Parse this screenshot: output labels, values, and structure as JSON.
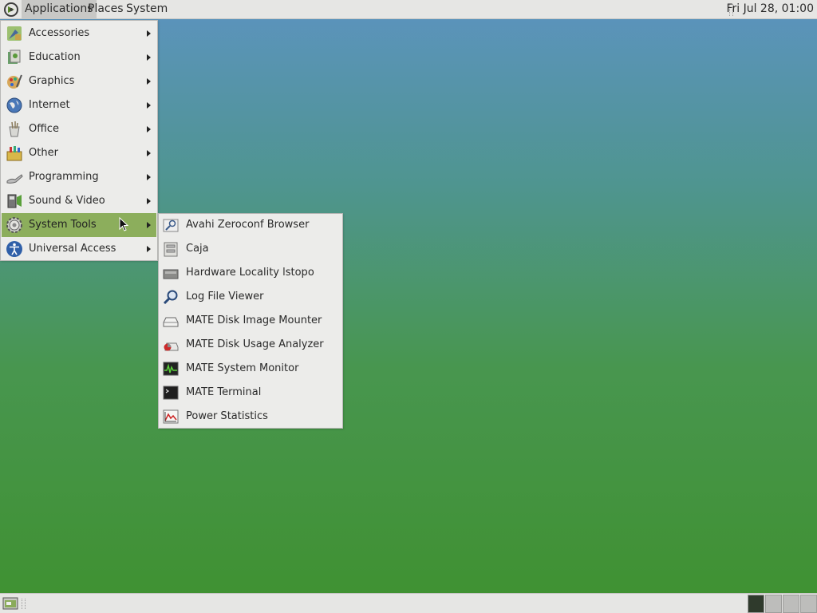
{
  "top_panel": {
    "menus": [
      "Applications",
      "Places",
      "System"
    ],
    "clock": "Fri Jul 28, 01:00"
  },
  "main_menu": {
    "items": [
      {
        "label": "Accessories",
        "icon": "accessories-icon"
      },
      {
        "label": "Education",
        "icon": "education-icon"
      },
      {
        "label": "Graphics",
        "icon": "graphics-icon"
      },
      {
        "label": "Internet",
        "icon": "internet-globe-icon"
      },
      {
        "label": "Office",
        "icon": "office-icon"
      },
      {
        "label": "Other",
        "icon": "other-toolbox-icon"
      },
      {
        "label": "Programming",
        "icon": "programming-icon"
      },
      {
        "label": "Sound & Video",
        "icon": "sound-video-icon"
      },
      {
        "label": "System Tools",
        "icon": "system-tools-gear-icon",
        "highlighted": true
      },
      {
        "label": "Universal Access",
        "icon": "universal-access-icon"
      }
    ]
  },
  "system_tools_submenu": {
    "items": [
      {
        "label": "Avahi Zeroconf Browser",
        "icon": "avahi-browser-icon"
      },
      {
        "label": "Caja",
        "icon": "caja-file-manager-icon"
      },
      {
        "label": "Hardware Locality lstopo",
        "icon": "hardware-locality-icon"
      },
      {
        "label": "Log File Viewer",
        "icon": "log-viewer-magnifier-icon"
      },
      {
        "label": "MATE Disk Image Mounter",
        "icon": "disk-image-mounter-icon"
      },
      {
        "label": "MATE Disk Usage Analyzer",
        "icon": "disk-usage-analyzer-icon"
      },
      {
        "label": "MATE System Monitor",
        "icon": "system-monitor-icon"
      },
      {
        "label": "MATE Terminal",
        "icon": "terminal-icon"
      },
      {
        "label": "Power Statistics",
        "icon": "power-statistics-icon"
      }
    ]
  },
  "colors": {
    "panel_bg": "#e6e6e4",
    "menu_bg": "#ececea",
    "highlight": "#8cae5c",
    "desktop_top": "#5c93bf",
    "desktop_bottom": "#3f9130"
  },
  "bottom_panel": {
    "workspaces": 4,
    "active_workspace": 1
  }
}
